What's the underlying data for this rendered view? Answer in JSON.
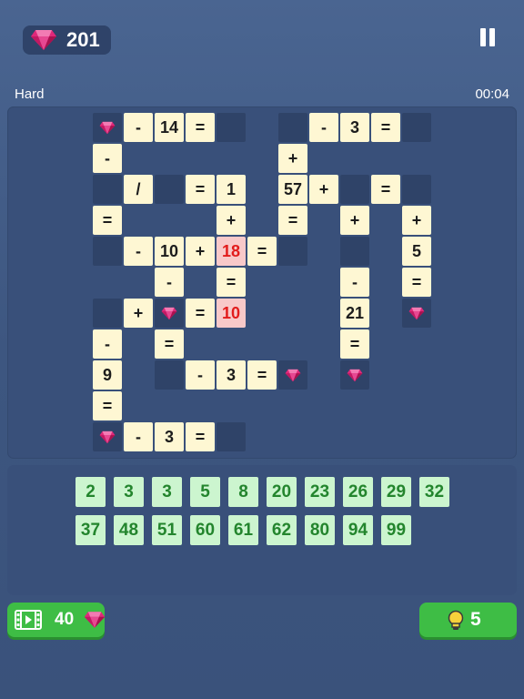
{
  "header": {
    "gem_count": "201",
    "difficulty": "Hard",
    "timer": "00:04"
  },
  "colors": {
    "background": "#3d5680",
    "cell": "#fef7d3",
    "cell_highlight": "#f8c9c9",
    "highlight_text": "#e21c1c",
    "empty_slot": "#2f4368",
    "tile": "#ccf5cf",
    "tile_text": "#23852d",
    "button": "#3ebd45",
    "gem": "#e0287a"
  },
  "board": {
    "cells": [
      {
        "t": "gem",
        "r": 0,
        "c": 0
      },
      {
        "t": "op",
        "v": "-",
        "r": 0,
        "c": 1
      },
      {
        "t": "num",
        "v": "14",
        "r": 0,
        "c": 2
      },
      {
        "t": "op",
        "v": "=",
        "r": 0,
        "c": 3
      },
      {
        "t": "empty",
        "r": 0,
        "c": 4
      },
      {
        "t": "empty",
        "r": 0,
        "c": 6
      },
      {
        "t": "op",
        "v": "-",
        "r": 0,
        "c": 7
      },
      {
        "t": "num",
        "v": "3",
        "r": 0,
        "c": 8
      },
      {
        "t": "op",
        "v": "=",
        "r": 0,
        "c": 9
      },
      {
        "t": "empty",
        "r": 0,
        "c": 10
      },
      {
        "t": "op",
        "v": "-",
        "r": 1,
        "c": 0
      },
      {
        "t": "op",
        "v": "+",
        "r": 1,
        "c": 6
      },
      {
        "t": "empty",
        "r": 2,
        "c": 0
      },
      {
        "t": "op",
        "v": "/",
        "r": 2,
        "c": 1
      },
      {
        "t": "empty",
        "r": 2,
        "c": 2
      },
      {
        "t": "op",
        "v": "=",
        "r": 2,
        "c": 3
      },
      {
        "t": "num",
        "v": "1",
        "r": 2,
        "c": 4
      },
      {
        "t": "num",
        "v": "57",
        "r": 2,
        "c": 6
      },
      {
        "t": "op",
        "v": "+",
        "r": 2,
        "c": 7
      },
      {
        "t": "empty",
        "r": 2,
        "c": 8
      },
      {
        "t": "op",
        "v": "=",
        "r": 2,
        "c": 9
      },
      {
        "t": "empty",
        "r": 2,
        "c": 10
      },
      {
        "t": "op",
        "v": "=",
        "r": 3,
        "c": 0
      },
      {
        "t": "op",
        "v": "+",
        "r": 3,
        "c": 4
      },
      {
        "t": "op",
        "v": "=",
        "r": 3,
        "c": 6
      },
      {
        "t": "op",
        "v": "+",
        "r": 3,
        "c": 8
      },
      {
        "t": "op",
        "v": "+",
        "r": 3,
        "c": 10
      },
      {
        "t": "empty",
        "r": 4,
        "c": 0
      },
      {
        "t": "op",
        "v": "-",
        "r": 4,
        "c": 1
      },
      {
        "t": "num",
        "v": "10",
        "r": 4,
        "c": 2
      },
      {
        "t": "op",
        "v": "+",
        "r": 4,
        "c": 3
      },
      {
        "t": "red",
        "v": "18",
        "r": 4,
        "c": 4
      },
      {
        "t": "op",
        "v": "=",
        "r": 4,
        "c": 5
      },
      {
        "t": "empty",
        "r": 4,
        "c": 6
      },
      {
        "t": "empty",
        "r": 4,
        "c": 8
      },
      {
        "t": "num",
        "v": "5",
        "r": 4,
        "c": 10
      },
      {
        "t": "op",
        "v": "-",
        "r": 5,
        "c": 2
      },
      {
        "t": "op",
        "v": "=",
        "r": 5,
        "c": 4
      },
      {
        "t": "op",
        "v": "-",
        "r": 5,
        "c": 8
      },
      {
        "t": "op",
        "v": "=",
        "r": 5,
        "c": 10
      },
      {
        "t": "empty",
        "r": 6,
        "c": 0
      },
      {
        "t": "op",
        "v": "+",
        "r": 6,
        "c": 1
      },
      {
        "t": "gem",
        "r": 6,
        "c": 2
      },
      {
        "t": "op",
        "v": "=",
        "r": 6,
        "c": 3
      },
      {
        "t": "red",
        "v": "10",
        "r": 6,
        "c": 4
      },
      {
        "t": "num",
        "v": "21",
        "r": 6,
        "c": 8
      },
      {
        "t": "gem",
        "r": 6,
        "c": 10
      },
      {
        "t": "op",
        "v": "-",
        "r": 7,
        "c": 0
      },
      {
        "t": "op",
        "v": "=",
        "r": 7,
        "c": 2
      },
      {
        "t": "op",
        "v": "=",
        "r": 7,
        "c": 8
      },
      {
        "t": "num",
        "v": "9",
        "r": 8,
        "c": 0
      },
      {
        "t": "empty",
        "r": 8,
        "c": 2
      },
      {
        "t": "op",
        "v": "-",
        "r": 8,
        "c": 3
      },
      {
        "t": "num",
        "v": "3",
        "r": 8,
        "c": 4
      },
      {
        "t": "op",
        "v": "=",
        "r": 8,
        "c": 5
      },
      {
        "t": "gem",
        "r": 8,
        "c": 6
      },
      {
        "t": "gem",
        "r": 8,
        "c": 8
      },
      {
        "t": "op",
        "v": "=",
        "r": 9,
        "c": 0
      },
      {
        "t": "gem",
        "r": 10,
        "c": 0
      },
      {
        "t": "op",
        "v": "-",
        "r": 10,
        "c": 1
      },
      {
        "t": "num",
        "v": "3",
        "r": 10,
        "c": 2
      },
      {
        "t": "op",
        "v": "=",
        "r": 10,
        "c": 3
      },
      {
        "t": "empty",
        "r": 10,
        "c": 4
      }
    ]
  },
  "tray": {
    "tiles": [
      "2",
      "3",
      "3",
      "5",
      "8",
      "20",
      "23",
      "26",
      "29",
      "32",
      "37",
      "48",
      "51",
      "60",
      "61",
      "62",
      "80",
      "94",
      "99"
    ]
  },
  "buttons": {
    "video": {
      "icon": "film-icon",
      "cost": "40"
    },
    "hint": {
      "icon": "lightbulb-icon",
      "count": "5"
    }
  }
}
